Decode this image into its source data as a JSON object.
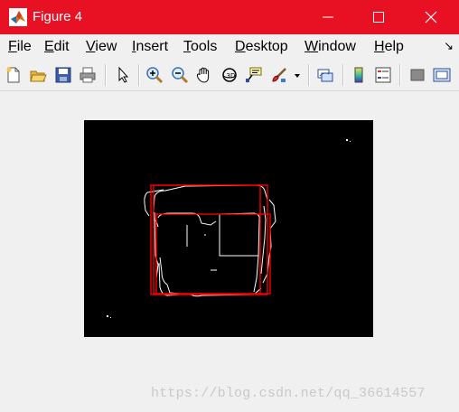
{
  "window": {
    "title": "Figure 4",
    "icon": "matlab-logo-icon",
    "title_bar_color": "#e81123",
    "controls": [
      "minimize-icon",
      "maximize-icon",
      "close-icon"
    ]
  },
  "menu": {
    "items": [
      {
        "label": "File",
        "mnemonic": "F",
        "rest": "ile"
      },
      {
        "label": "Edit",
        "mnemonic": "E",
        "rest": "dit"
      },
      {
        "label": "View",
        "mnemonic": "V",
        "rest": "iew"
      },
      {
        "label": "Insert",
        "mnemonic": "I",
        "rest": "nsert"
      },
      {
        "label": "Tools",
        "mnemonic": "T",
        "rest": "ools"
      },
      {
        "label": "Desktop",
        "mnemonic": "D",
        "rest": "esktop"
      },
      {
        "label": "Window",
        "mnemonic": "W",
        "rest": "indow"
      },
      {
        "label": "Help",
        "mnemonic": "H",
        "rest": "elp"
      }
    ],
    "dock_arrow": "↘"
  },
  "toolbar": {
    "buttons": [
      "new-figure-icon",
      "open-file-icon",
      "save-icon",
      "print-icon",
      "edit-plot-pointer-icon",
      "zoom-in-icon",
      "zoom-out-icon",
      "pan-hand-icon",
      "rotate-3d-icon",
      "data-cursor-icon",
      "brush-icon",
      "brush-dropdown-icon",
      "link-plot-icon",
      "insert-colorbar-icon",
      "insert-legend-icon",
      "hide-plot-tools-icon",
      "show-plot-tools-icon"
    ]
  },
  "figure": {
    "image_description": "binary edge image of a box-shaped object with red bounding rectangles",
    "edge_color": "#ffffff",
    "box_color": "#ff0000",
    "background": "#000000"
  },
  "watermark": {
    "text": "https://blog.csdn.net/qq_36614557"
  }
}
